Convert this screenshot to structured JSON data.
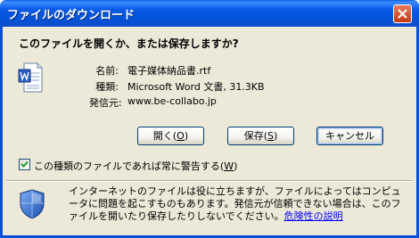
{
  "window": {
    "title": "ファイルのダウンロード"
  },
  "prompt": {
    "question": "このファイルを開くか、または保存しますか?"
  },
  "file": {
    "icon": "word-document-icon",
    "name_label": "名前:",
    "name_value": "電子媒体納品書.rtf",
    "type_label": "種類:",
    "type_value": "Microsoft Word 文書, 31.3KB",
    "from_label": "発信元:",
    "from_value": "www.be-collabo.jp"
  },
  "buttons": {
    "open": {
      "text": "開く(",
      "key": "O",
      "end": ")"
    },
    "save": {
      "text": "保存(",
      "key": "S",
      "end": ")"
    },
    "cancel": "キャンセル"
  },
  "checkbox": {
    "checked": true,
    "text": "この種類のファイルであれば常に警告する(",
    "key": "W",
    "end": ")"
  },
  "warning": {
    "icon": "security-shield-icon",
    "text": "インターネットのファイルは役に立ちますが、ファイルによってはコンピュータに問題を起こすものもあります。発信元が信頼できない場合は、このファイルを開いたり保存したりしないでください。",
    "link": "危険性の説明"
  },
  "colors": {
    "titlebar": "#0a5ae6",
    "client": "#ece9d8",
    "link": "#0000ff"
  }
}
